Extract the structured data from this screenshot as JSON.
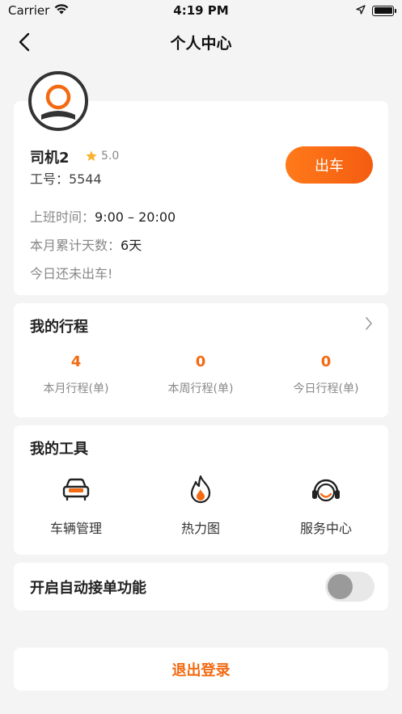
{
  "status_bar": {
    "carrier": "Carrier",
    "time": "4:19 PM"
  },
  "nav": {
    "title": "个人中心"
  },
  "profile": {
    "name": "司机2",
    "rating": "5.0",
    "staff_id": "工号：5544",
    "go_button": "出车",
    "shift_label": "上班时间：",
    "shift_value": "9:00 – 20:00",
    "days_label": "本月累计天数：",
    "days_value": "6天",
    "notice": "今日还未出车!"
  },
  "trips": {
    "title": "我的行程",
    "stats": [
      {
        "value": "4",
        "label": "本月行程(单)"
      },
      {
        "value": "0",
        "label": "本周行程(单)"
      },
      {
        "value": "0",
        "label": "今日行程(单)"
      }
    ]
  },
  "tools": {
    "title": "我的工具",
    "items": [
      {
        "label": "车辆管理",
        "icon": "car-icon"
      },
      {
        "label": "热力图",
        "icon": "flame-icon"
      },
      {
        "label": "服务中心",
        "icon": "headset-icon"
      }
    ]
  },
  "auto_order": {
    "label": "开启自动接单功能",
    "enabled": false
  },
  "logout": {
    "label": "退出登录"
  },
  "colors": {
    "accent": "#f36a12",
    "background": "#f4f4f4",
    "card": "#ffffff"
  }
}
